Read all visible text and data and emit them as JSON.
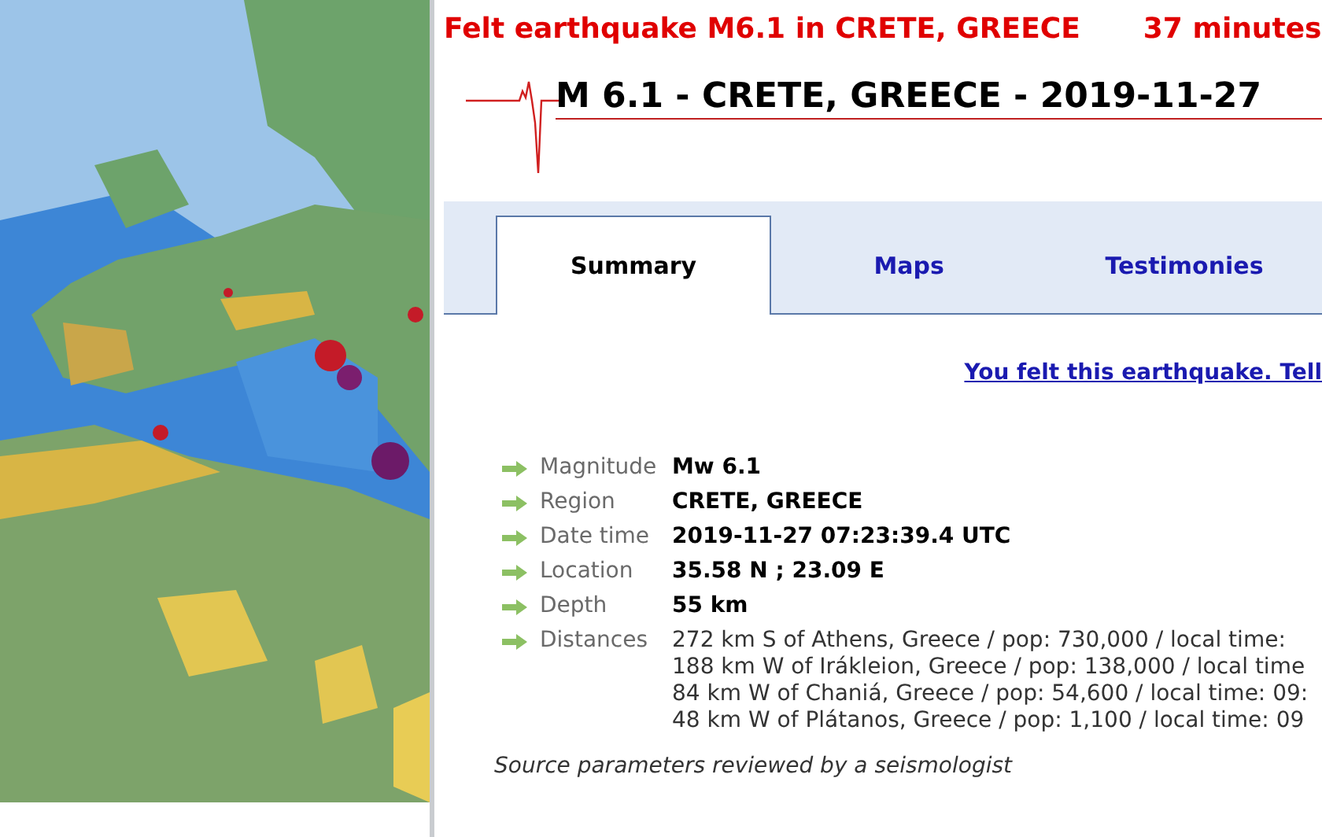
{
  "alert": {
    "title": "Felt earthquake M6.1 in CRETE, GREECE",
    "age": "37 minutes"
  },
  "event_title": "M 6.1 - CRETE, GREECE - 2019-11-27",
  "tabs": [
    {
      "label": "Summary",
      "selected": true
    },
    {
      "label": "Maps",
      "selected": false
    },
    {
      "label": "Testimonies",
      "selected": false
    }
  ],
  "felt_link": "You felt this earthquake. Tell",
  "details": [
    {
      "label": "Magnitude",
      "values": [
        "Mw 6.1"
      ],
      "bold": true
    },
    {
      "label": "Region",
      "values": [
        "CRETE, GREECE"
      ],
      "bold": true
    },
    {
      "label": "Date time",
      "values": [
        "2019-11-27 07:23:39.4 UTC"
      ],
      "bold": true
    },
    {
      "label": "Location",
      "values": [
        "35.58 N ; 23.09 E"
      ],
      "bold": true
    },
    {
      "label": "Depth",
      "values": [
        "55 km"
      ],
      "bold": true
    },
    {
      "label": "Distances",
      "values": [
        "272 km S of Athens, Greece / pop: 730,000 / local time:",
        "188 km W of Irákleion, Greece / pop: 138,000 / local time",
        "84 km W of Chaniá, Greece / pop: 54,600 / local time: 09:",
        "48 km W of Plátanos, Greece / pop: 1,100 / local time: 09"
      ],
      "bold": false
    }
  ],
  "review_note": "Source parameters reviewed by a seismologist"
}
